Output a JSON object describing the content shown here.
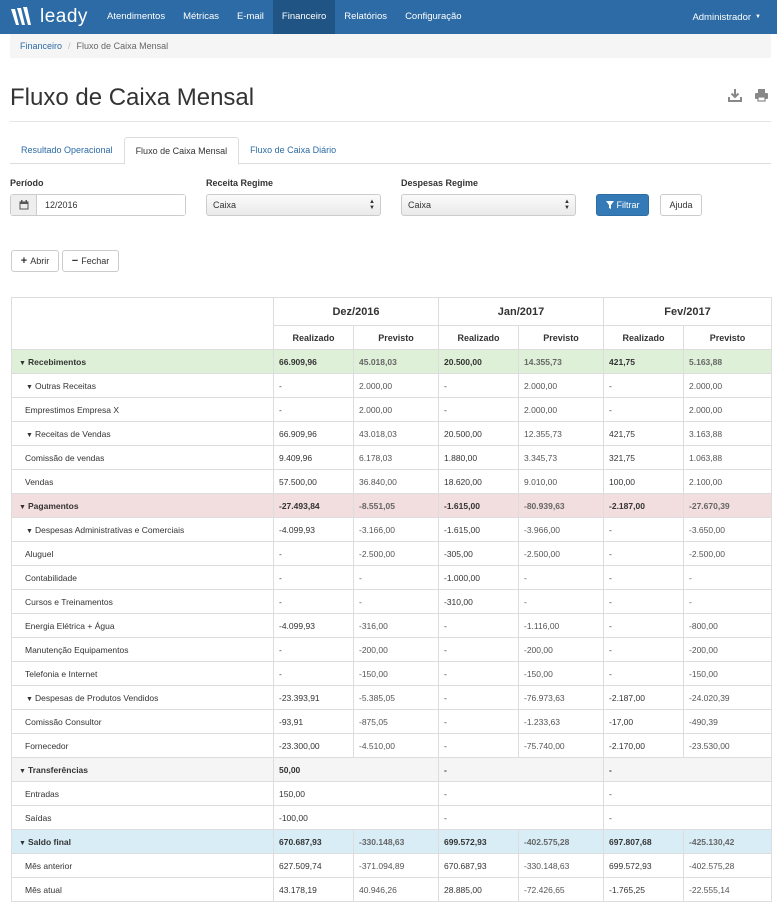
{
  "navbar": {
    "brand": "leady",
    "items": [
      "Atendimentos",
      "Métricas",
      "E-mail",
      "Financeiro",
      "Relatórios",
      "Configuração"
    ],
    "active_index": 3,
    "user": "Administrador"
  },
  "breadcrumb": {
    "parent": "Financeiro",
    "current": "Fluxo de Caixa Mensal"
  },
  "page": {
    "title": "Fluxo de Caixa Mensal"
  },
  "tabs": [
    "Resultado Operacional",
    "Fluxo de Caixa Mensal",
    "Fluxo de Caixa Diário"
  ],
  "active_tab": 1,
  "filters": {
    "periodo_label": "Período",
    "periodo_value": "12/2016",
    "receita_label": "Receita Regime",
    "receita_value": "Caixa",
    "despesas_label": "Despesas Regime",
    "despesas_value": "Caixa",
    "filtrar": "Filtrar",
    "ajuda": "Ajuda"
  },
  "actions": {
    "abrir": "Abrir",
    "fechar": "Fechar"
  },
  "table": {
    "periods": [
      "Dez/2016",
      "Jan/2017",
      "Fev/2017"
    ],
    "sub_realizado": "Realizado",
    "sub_previsto": "Previsto",
    "rows": [
      {
        "label": "Recebimentos",
        "level": 0,
        "chev": true,
        "style": "green",
        "vals": [
          "66.909,96",
          "45.018,03",
          "20.500,00",
          "14.355,73",
          "421,75",
          "5.163,88"
        ]
      },
      {
        "label": "Outras Receitas",
        "level": 1,
        "chev": true,
        "style": "",
        "vals": [
          "-",
          "2.000,00",
          "-",
          "2.000,00",
          "-",
          "2.000,00"
        ]
      },
      {
        "label": "Emprestimos Empresa X",
        "level": 2,
        "chev": false,
        "style": "",
        "vals": [
          "-",
          "2.000,00",
          "-",
          "2.000,00",
          "-",
          "2.000,00"
        ]
      },
      {
        "label": "Receitas de Vendas",
        "level": 1,
        "chev": true,
        "style": "",
        "vals": [
          "66.909,96",
          "43.018,03",
          "20.500,00",
          "12.355,73",
          "421,75",
          "3.163,88"
        ]
      },
      {
        "label": "Comissão de vendas",
        "level": 2,
        "chev": false,
        "style": "",
        "vals": [
          "9.409,96",
          "6.178,03",
          "1.880,00",
          "3.345,73",
          "321,75",
          "1.063,88"
        ]
      },
      {
        "label": "Vendas",
        "level": 2,
        "chev": false,
        "style": "",
        "vals": [
          "57.500,00",
          "36.840,00",
          "18.620,00",
          "9.010,00",
          "100,00",
          "2.100,00"
        ]
      },
      {
        "label": "Pagamentos",
        "level": 0,
        "chev": true,
        "style": "red",
        "vals": [
          "-27.493,84",
          "-8.551,05",
          "-1.615,00",
          "-80.939,63",
          "-2.187,00",
          "-27.670,39"
        ]
      },
      {
        "label": "Despesas Administrativas e Comerciais",
        "level": 1,
        "chev": true,
        "style": "",
        "vals": [
          "-4.099,93",
          "-3.166,00",
          "-1.615,00",
          "-3.966,00",
          "-",
          "-3.650,00"
        ]
      },
      {
        "label": "Aluguel",
        "level": 2,
        "chev": false,
        "style": "",
        "vals": [
          "-",
          "-2.500,00",
          "-305,00",
          "-2.500,00",
          "-",
          "-2.500,00"
        ]
      },
      {
        "label": "Contabilidade",
        "level": 2,
        "chev": false,
        "style": "",
        "vals": [
          "-",
          "-",
          "-1.000,00",
          "-",
          "-",
          "-"
        ]
      },
      {
        "label": "Cursos e Treinamentos",
        "level": 2,
        "chev": false,
        "style": "",
        "vals": [
          "-",
          "-",
          "-310,00",
          "-",
          "-",
          "-"
        ]
      },
      {
        "label": "Energia Elétrica + Água",
        "level": 2,
        "chev": false,
        "style": "",
        "vals": [
          "-4.099,93",
          "-316,00",
          "-",
          "-1.116,00",
          "-",
          "-800,00"
        ]
      },
      {
        "label": "Manutenção Equipamentos",
        "level": 2,
        "chev": false,
        "style": "",
        "vals": [
          "-",
          "-200,00",
          "-",
          "-200,00",
          "-",
          "-200,00"
        ]
      },
      {
        "label": "Telefonia e Internet",
        "level": 2,
        "chev": false,
        "style": "",
        "vals": [
          "-",
          "-150,00",
          "-",
          "-150,00",
          "-",
          "-150,00"
        ]
      },
      {
        "label": "Despesas de Produtos Vendidos",
        "level": 1,
        "chev": true,
        "style": "",
        "vals": [
          "-23.393,91",
          "-5.385,05",
          "-",
          "-76.973,63",
          "-2.187,00",
          "-24.020,39"
        ]
      },
      {
        "label": "Comissão Consultor",
        "level": 2,
        "chev": false,
        "style": "",
        "vals": [
          "-93,91",
          "-875,05",
          "-",
          "-1.233,63",
          "-17,00",
          "-490,39"
        ]
      },
      {
        "label": "Fornecedor",
        "level": 2,
        "chev": false,
        "style": "",
        "vals": [
          "-23.300,00",
          "-4.510,00",
          "-",
          "-75.740,00",
          "-2.170,00",
          "-23.530,00"
        ]
      },
      {
        "label": "Transferências",
        "level": 0,
        "chev": true,
        "style": "gray",
        "merged": true,
        "vals": [
          "50,00",
          "-",
          "-"
        ]
      },
      {
        "label": "Entradas",
        "level": 1,
        "chev": false,
        "style": "",
        "merged": true,
        "vals": [
          "150,00",
          "-",
          "-"
        ]
      },
      {
        "label": "Saídas",
        "level": 1,
        "chev": false,
        "style": "",
        "merged": true,
        "vals": [
          "-100,00",
          "-",
          "-"
        ]
      },
      {
        "label": "Saldo final",
        "level": 0,
        "chev": true,
        "style": "blue",
        "vals": [
          "670.687,93",
          "-330.148,63",
          "699.572,93",
          "-402.575,28",
          "697.807,68",
          "-425.130,42"
        ]
      },
      {
        "label": "Mês anterior",
        "level": 1,
        "chev": false,
        "style": "",
        "vals": [
          "627.509,74",
          "-371.094,89",
          "670.687,93",
          "-330.148,63",
          "699.572,93",
          "-402.575,28"
        ]
      },
      {
        "label": "Mês atual",
        "level": 1,
        "chev": false,
        "style": "",
        "vals": [
          "43.178,19",
          "40.946,26",
          "28.885,00",
          "-72.426,65",
          "-1.765,25",
          "-22.555,14"
        ]
      }
    ]
  }
}
